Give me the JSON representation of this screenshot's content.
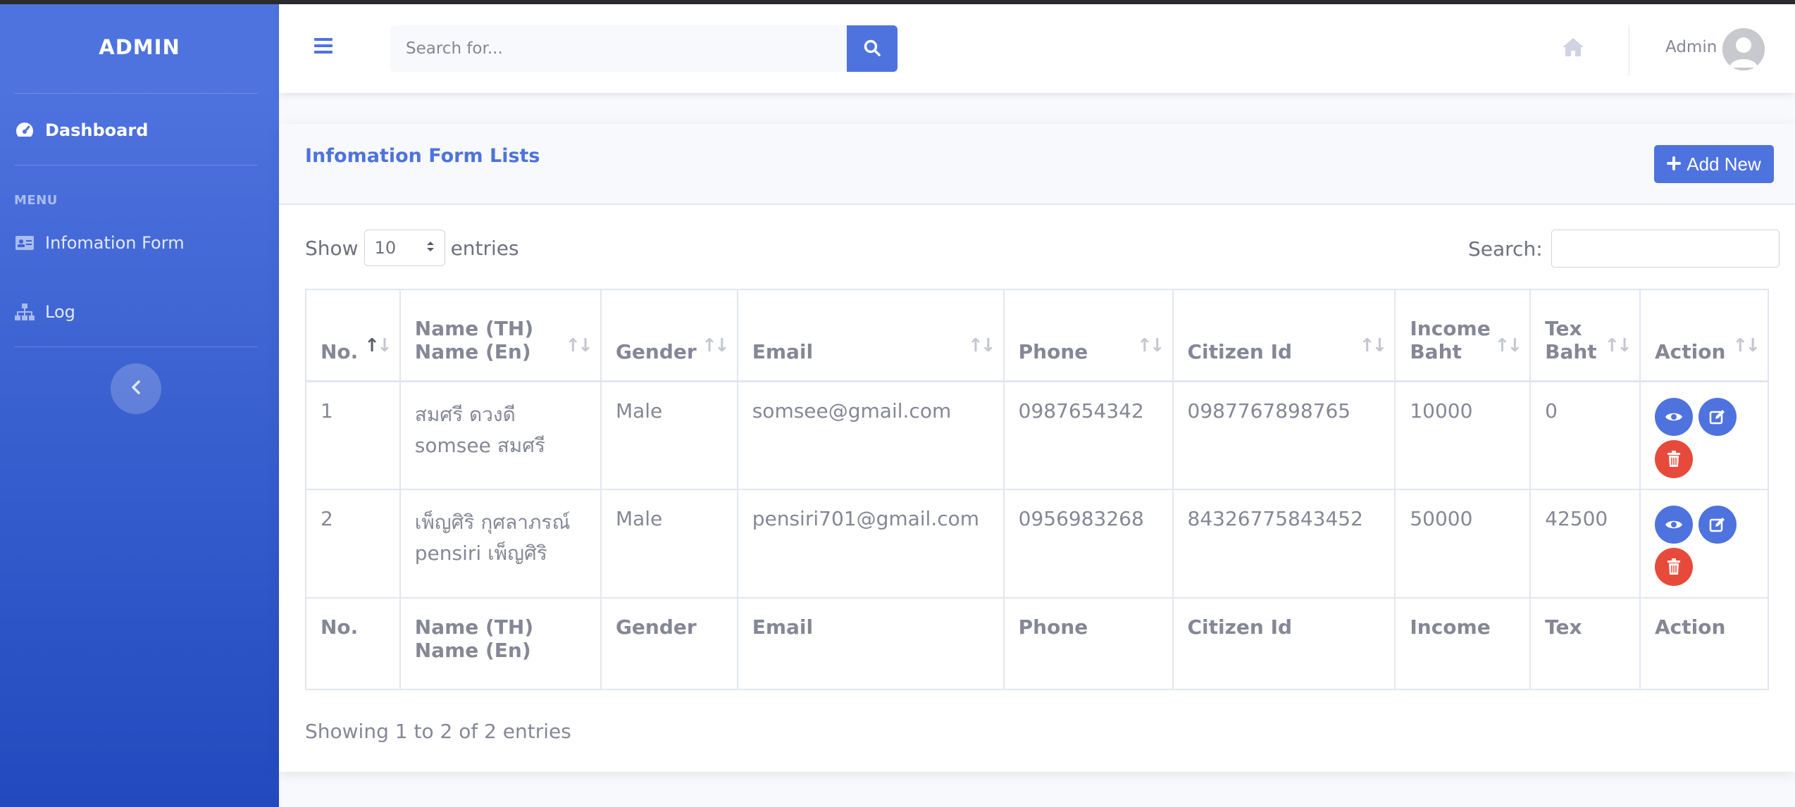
{
  "sidebar": {
    "brand": "ADMIN",
    "dashboard_label": "Dashboard",
    "menu_heading": "MENU",
    "items": [
      {
        "label": "Infomation Form",
        "icon": "id-card-icon"
      },
      {
        "label": "Log",
        "icon": "sitemap-icon"
      }
    ],
    "toggle_icon": "chevron-left-icon"
  },
  "topbar": {
    "search_placeholder": "Search for...",
    "user_name": "Admin",
    "accent": "#4e73df"
  },
  "card": {
    "title": "Infomation Form Lists",
    "add_label": "Add New",
    "show_label": "Show",
    "entries_label": "entries",
    "page_length": "10",
    "search_label": "Search:",
    "info": "Showing 1 to 2 of 2 entries"
  },
  "table": {
    "headers": [
      "No.",
      "Name (TH)",
      "Name (En)",
      "Gender",
      "Email",
      "Phone",
      "Citizen Id",
      "Income",
      "Baht",
      "Tex",
      "Baht",
      "Action"
    ],
    "footers": [
      "No.",
      "Name (TH)",
      "Name (En)",
      "Gender",
      "Email",
      "Phone",
      "Citizen Id",
      "Income",
      "Tex",
      "Action"
    ],
    "rows": [
      {
        "no": "1",
        "name_th": "สมศรี ดวงดี",
        "name_en": "somsee สมศรี",
        "gender": "Male",
        "email": "somsee@gmail.com",
        "phone": "0987654342",
        "citizen": "0987767898765",
        "income": "10000",
        "tex": "0"
      },
      {
        "no": "2",
        "name_th": "เพ็ญศิริ กุศลาภรณ์",
        "name_en": "pensiri เพ็ญศิริ",
        "gender": "Male",
        "email": "pensiri701@gmail.com",
        "phone": "0956983268",
        "citizen": "84326775843452",
        "income": "50000",
        "tex": "42500"
      }
    ]
  },
  "colors": {
    "primary": "#4e73df",
    "danger": "#e74a3b"
  }
}
